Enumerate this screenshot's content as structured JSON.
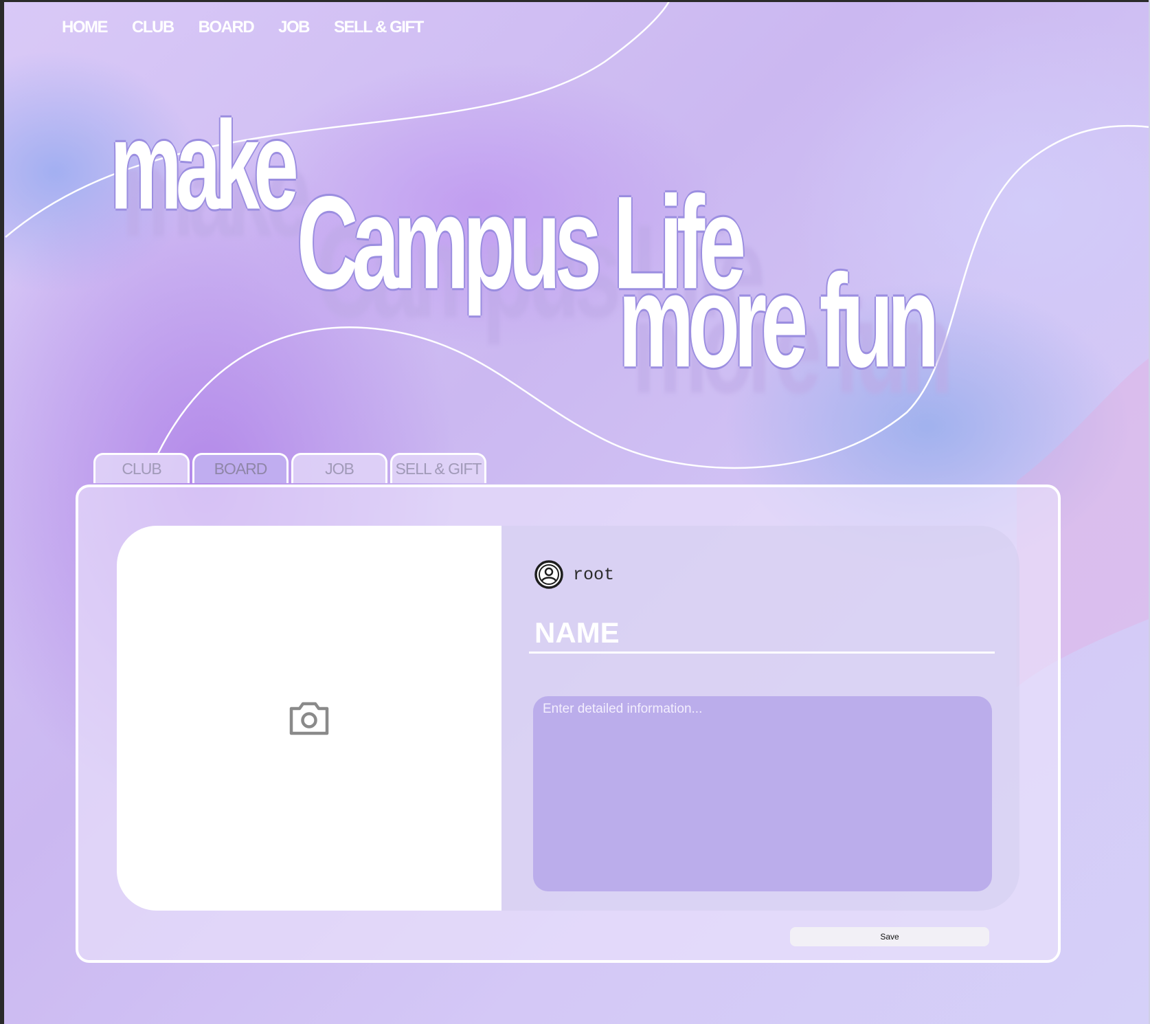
{
  "nav": {
    "items": [
      "HOME",
      "CLUB",
      "BOARD",
      "JOB",
      "SELL & GIFT"
    ]
  },
  "hero": {
    "line1": "make",
    "line2": "Campus Life",
    "line3": "more fun"
  },
  "tabs": {
    "items": [
      "CLUB",
      "BOARD",
      "JOB",
      "SELL & GIFT"
    ],
    "active": "BOARD"
  },
  "form": {
    "photo_icon": "camera-icon",
    "avatar_icon": "user-circle-icon",
    "username": "root",
    "name_placeholder": "NAME",
    "detail_placeholder": "Enter detailed information...",
    "save_label": "Save"
  },
  "colors": {
    "accent": "#c0adf0",
    "textarea": "#b0a0e8",
    "tab_inactive": "#e2d6f8"
  }
}
